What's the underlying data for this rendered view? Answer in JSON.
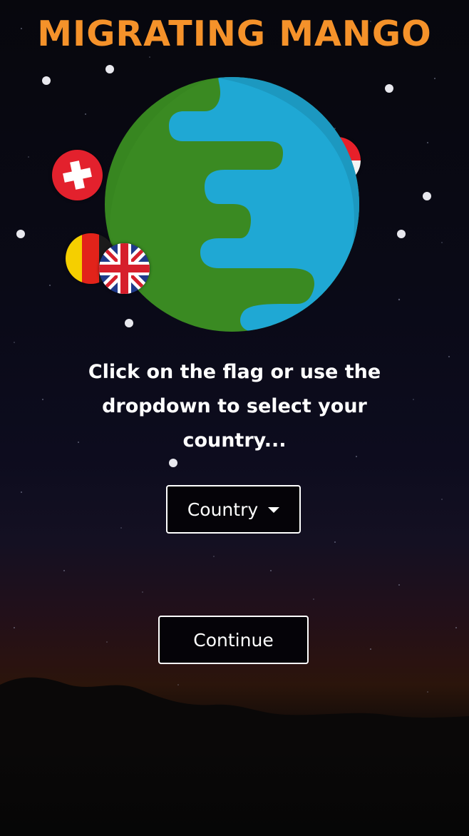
{
  "app": {
    "title": "MIGRATING MANGO"
  },
  "main": {
    "prompt": "Click on the flag or use the dropdown to select your country...",
    "country_dropdown": {
      "selected_label": "Country"
    },
    "continue_label": "Continue"
  },
  "flags": [
    {
      "name": "switzerland-flag"
    },
    {
      "name": "germany-flag"
    },
    {
      "name": "united-kingdom-flag"
    },
    {
      "name": "red-white-flag"
    }
  ],
  "colors": {
    "title": "#f5922a",
    "globe_land": "#3a8a22",
    "globe_water": "#1fa8d4",
    "globe_shadow": "#1a8aae",
    "button_border": "#ffffff",
    "dots": "#e8e8ee"
  }
}
